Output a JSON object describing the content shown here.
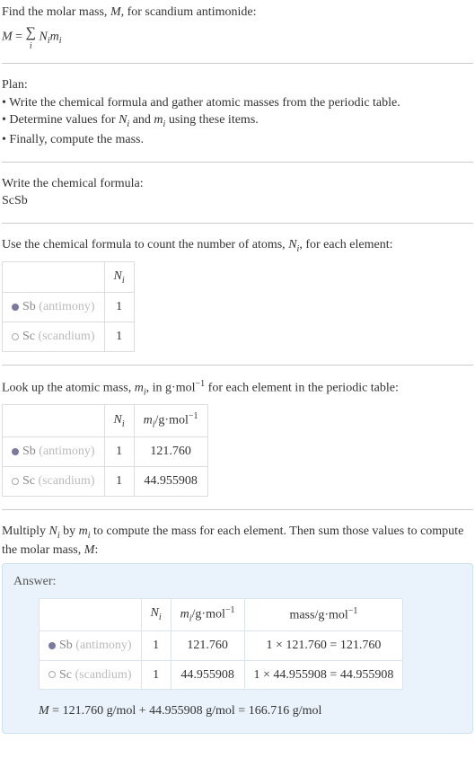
{
  "intro": {
    "line1_a": "Find the molar mass, ",
    "line1_m": "M",
    "line1_b": ", for scandium antimonide:",
    "eq_lhs": "M",
    "eq_eq": " = ",
    "eq_rhs": "N",
    "eq_rhs_sub1": "i",
    "eq_rhs2": "m",
    "eq_rhs_sub2": "i",
    "sum_sub": "i"
  },
  "plan": {
    "heading": "Plan:",
    "b1a": "• Write the chemical formula and gather atomic masses from the periodic table.",
    "b2a": "• Determine values for ",
    "b2_n": "N",
    "b2_nsub": "i",
    "b2b": " and ",
    "b2_m": "m",
    "b2_msub": "i",
    "b2c": " using these items.",
    "b3": "• Finally, compute the mass."
  },
  "chem": {
    "heading": "Write the chemical formula:",
    "formula": "ScSb"
  },
  "count": {
    "heading_a": "Use the chemical formula to count the number of atoms, ",
    "heading_n": "N",
    "heading_nsub": "i",
    "heading_b": ", for each element:",
    "col_n": "N",
    "col_nsub": "i",
    "rows": [
      {
        "abbr": "Sb",
        "name": "(antimony)",
        "n": "1"
      },
      {
        "abbr": "Sc",
        "name": "(scandium)",
        "n": "1"
      }
    ]
  },
  "lookup": {
    "heading_a": "Look up the atomic mass, ",
    "heading_m": "m",
    "heading_msub": "i",
    "heading_b": ", in g·mol",
    "heading_sup": "−1",
    "heading_c": " for each element in the periodic table:",
    "col_n": "N",
    "col_nsub": "i",
    "col_m": "m",
    "col_msub": "i",
    "col_munit": "/g·mol",
    "col_msup": "−1",
    "rows": [
      {
        "abbr": "Sb",
        "name": "(antimony)",
        "n": "1",
        "m": "121.760"
      },
      {
        "abbr": "Sc",
        "name": "(scandium)",
        "n": "1",
        "m": "44.955908"
      }
    ]
  },
  "multiply": {
    "heading_a": "Multiply ",
    "heading_n": "N",
    "heading_nsub": "i",
    "heading_b": " by ",
    "heading_m": "m",
    "heading_msub": "i",
    "heading_c": " to compute the mass for each element. Then sum those values to compute the molar mass, ",
    "heading_M": "M",
    "heading_d": ":"
  },
  "answer": {
    "label": "Answer:",
    "col_n": "N",
    "col_nsub": "i",
    "col_m": "m",
    "col_msub": "i",
    "col_munit": "/g·mol",
    "col_msup": "−1",
    "col_mass": "mass/g·mol",
    "col_mass_sup": "−1",
    "rows": [
      {
        "abbr": "Sb",
        "name": "(antimony)",
        "n": "1",
        "m": "121.760",
        "mass": "1 × 121.760 = 121.760"
      },
      {
        "abbr": "Sc",
        "name": "(scandium)",
        "n": "1",
        "m": "44.955908",
        "mass": "1 × 44.955908 = 44.955908"
      }
    ],
    "final_m": "M",
    "final_eq": " = 121.760 g/mol + 44.955908 g/mol = 166.716 g/mol"
  }
}
